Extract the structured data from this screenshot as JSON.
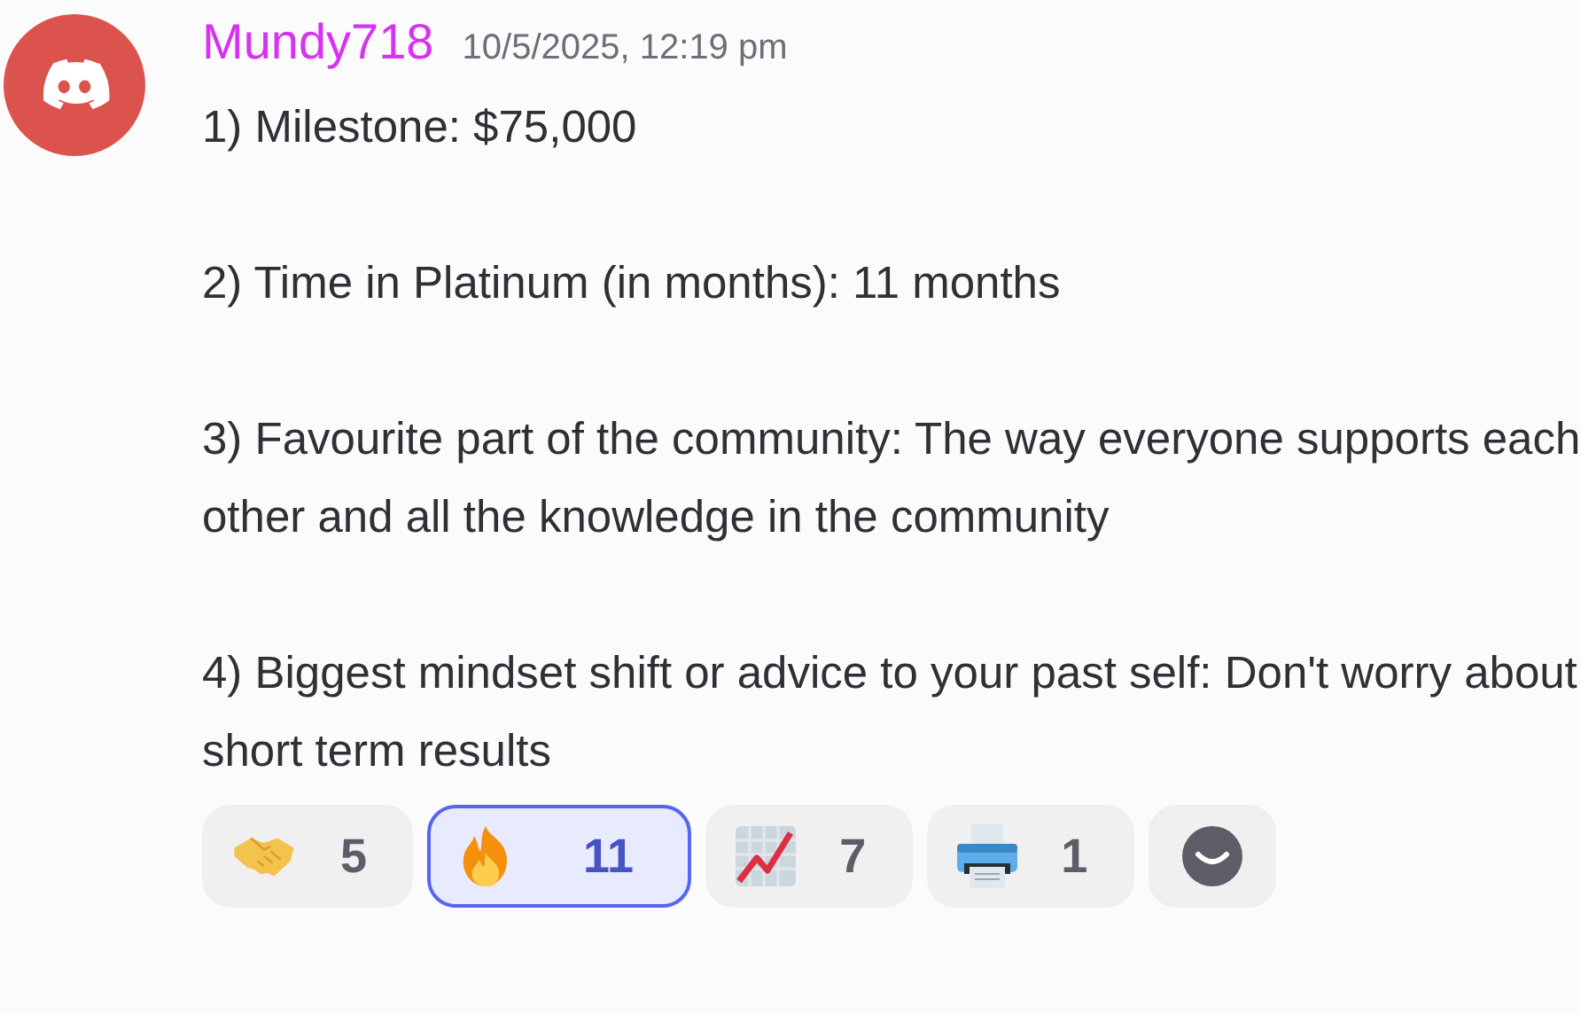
{
  "message": {
    "author": "Mundy718",
    "timestamp": "10/5/2025, 12:19 pm",
    "paragraphs": [
      "1) Milestone: $75,000",
      "2) Time in Platinum (in months): 11 months",
      "3) Favourite part of the community: The way everyone supports each other and all the knowledge in the community",
      "4) Biggest mindset shift or advice to your past self: Don't worry about short term results"
    ],
    "reactions": [
      {
        "kind": "handshake",
        "count": "5",
        "selected": false
      },
      {
        "kind": "fire",
        "count": "11",
        "selected": true
      },
      {
        "kind": "chart",
        "count": "7",
        "selected": false
      },
      {
        "kind": "printer",
        "count": "1",
        "selected": false
      },
      {
        "kind": "add",
        "selected": false
      }
    ]
  }
}
